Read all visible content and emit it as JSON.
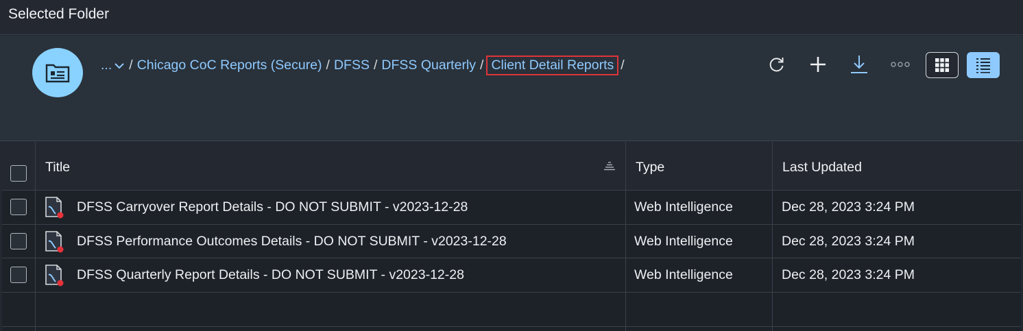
{
  "topbar": {
    "title": "Selected Folder"
  },
  "breadcrumb": {
    "ellipsis": "...",
    "items": [
      "Chicago CoC Reports (Secure)",
      "DFSS",
      "DFSS Quarterly"
    ],
    "current": "Client Detail Reports",
    "separator": "/"
  },
  "toolbar": {
    "icons": [
      "refresh-icon",
      "plus-icon",
      "download-icon",
      "more-icon",
      "grid-view-icon",
      "list-view-icon"
    ]
  },
  "table": {
    "columns": [
      "Title",
      "Type",
      "Last Updated"
    ],
    "rows": [
      {
        "title": "DFSS Carryover Report Details - DO NOT SUBMIT - v2023-12-28",
        "type": "Web Intelligence",
        "updated": "Dec 28, 2023 3:24 PM"
      },
      {
        "title": "DFSS Performance Outcomes Details - DO NOT SUBMIT - v2023-12-28",
        "type": "Web Intelligence",
        "updated": "Dec 28, 2023 3:24 PM"
      },
      {
        "title": "DFSS Quarterly Report Details - DO NOT SUBMIT - v2023-12-28",
        "type": "Web Intelligence",
        "updated": "Dec 28, 2023 3:24 PM"
      }
    ]
  },
  "colors": {
    "accent": "#8fcaff",
    "avatar": "#89d1ff",
    "highlight": "#e0343b",
    "doc_badge": "#e8323a"
  }
}
